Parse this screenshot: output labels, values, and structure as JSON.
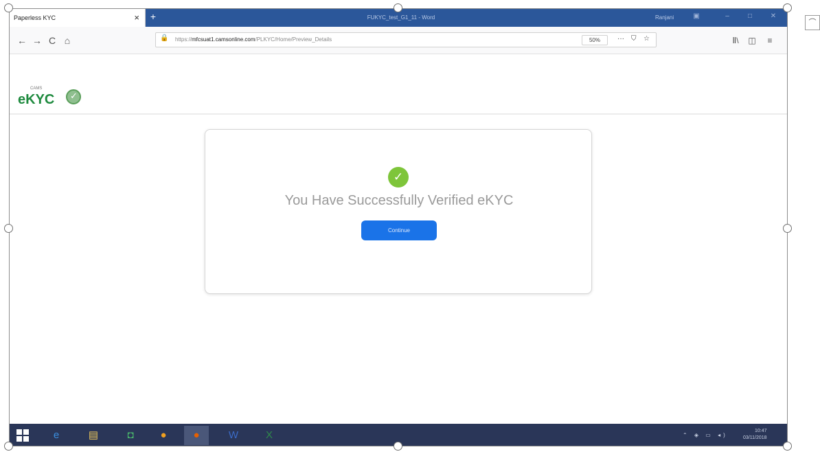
{
  "browser": {
    "tab_title": "Paperless KYC",
    "tab_close": "×",
    "new_tab": "+",
    "window_title": "FUKYC_test_G1_11 - Word",
    "window_user": "Ranjani",
    "url_prefix": "https://",
    "url_host": "mfcsuat1.camsonline.com",
    "url_path": "/PLKYC/Home/Preview_Details",
    "zoom": "50%"
  },
  "icons": {
    "back": "←",
    "forward": "→",
    "reload": "C",
    "home": "⌂",
    "lock": "🔒",
    "more": "···",
    "pocket": "⛉",
    "bookmark": "☆",
    "library": "Ⅱ\\",
    "sidebar": "◫",
    "menu": "≡"
  },
  "page": {
    "logo_small": "CAMS",
    "logo_main": "eKYC",
    "success_icon": "✓",
    "message": "You Have Successfully Verified eKYC",
    "continue_label": "Continue"
  },
  "taskbar": {
    "apps": [
      {
        "name": "internet-explorer-icon",
        "glyph": "e",
        "color": "#3b8fe0"
      },
      {
        "name": "file-explorer-icon",
        "glyph": "▤",
        "color": "#e8c45a"
      },
      {
        "name": "store-icon",
        "glyph": "◘",
        "color": "#49b36b"
      },
      {
        "name": "chrome-icon",
        "glyph": "●",
        "color": "#f0a020"
      },
      {
        "name": "firefox-icon",
        "glyph": "●",
        "color": "#e66000"
      },
      {
        "name": "word-icon",
        "glyph": "W",
        "color": "#3b6bc7"
      },
      {
        "name": "excel-icon",
        "glyph": "X",
        "color": "#2f8a4a"
      }
    ],
    "time": "10:47",
    "date": "03/11/2018"
  }
}
